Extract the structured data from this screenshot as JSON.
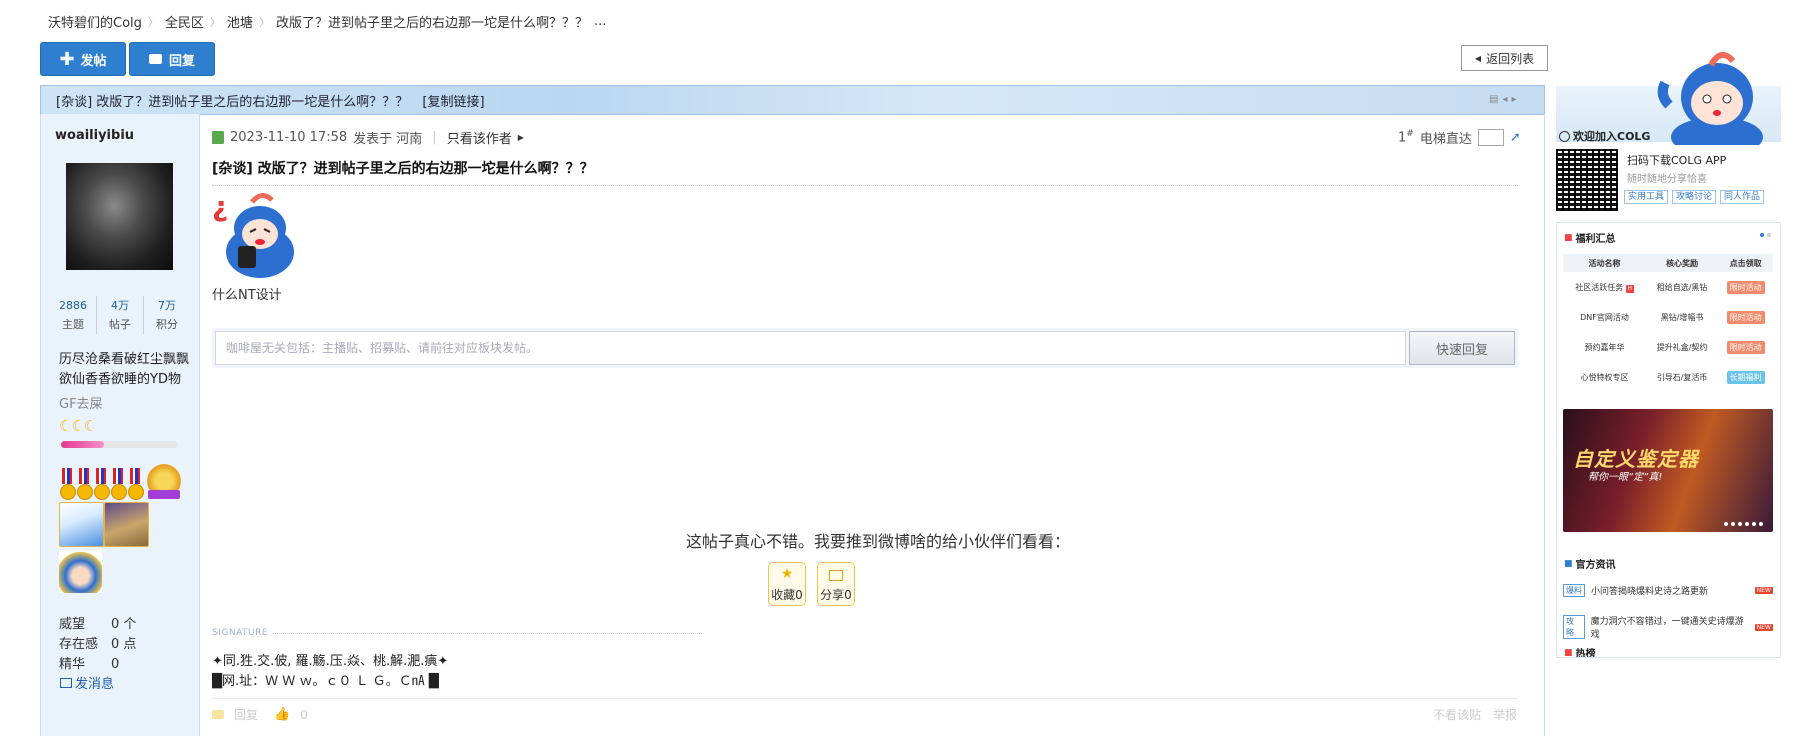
{
  "breadcrumbs": [
    "沃特碧们的Colg",
    "全民区",
    "池塘",
    "改版了？进到帖子里之后的右边那一坨是什么啊？？？",
    "..."
  ],
  "toolbar": {
    "post_label": "发帖",
    "reply_label": "回复",
    "back_label": "返回列表"
  },
  "thread": {
    "title": "[杂谈] 改版了？进到帖子里之后的右边那一坨是什么啊？？？",
    "copy_link": "[复制链接]"
  },
  "author": {
    "name": "woailiyibiu",
    "stats": [
      {
        "value": "2886",
        "label": "主题"
      },
      {
        "value": "4万",
        "label": "帖子"
      },
      {
        "value": "7万",
        "label": "积分"
      }
    ],
    "motto": "历尽沧桑看破红尘飘飘欲仙香香欲睡的YD物",
    "group": "GF去屎",
    "exp_progress": 0.37,
    "info": [
      {
        "k": "威望",
        "v": "0 个"
      },
      {
        "k": "存在感",
        "v": "0 点"
      },
      {
        "k": "精华",
        "v": "0"
      }
    ],
    "send_msg": "发消息"
  },
  "post": {
    "meta_time": "2023-11-10 17:58",
    "meta_from": "发表于 河南",
    "only_author": "只看该作者",
    "floor": "1",
    "floor_sup": "#",
    "elevator": "电梯直达",
    "title": "[杂谈] 改版了？进到帖子里之后的右边那一坨是什么啊？？？",
    "body": "什么NT设计",
    "quick_placeholder": "咖啡屋无关包括：主播贴、招募贴、请前往对应板块发帖。",
    "quick_btn": "快速回复",
    "share_text": "这帖子真心不错。我要推到微博啥的给小伙伴们看看：",
    "fav_label": "收藏0",
    "share_label": "分享0",
    "sig_label": "SIGNATURE",
    "sig_line1": "✦同.狌.交.佊, 羅.觞.压.焱、桃.解.淝.痶✦",
    "sig_line2": "█网.址：Ｗ Ｗ ｗ。ｃ０ Ｌ Ｇ。Ｃ㎁ █",
    "reply": "回复",
    "likes": "0",
    "no_see": "不看该贴",
    "report": "举报"
  },
  "right": {
    "welcome": "欢迎加入COLG",
    "app_title": "扫码下载COLG APP",
    "app_sub": "随时随地分享恰喜",
    "app_tags": [
      "实用工具",
      "攻略讨论",
      "同人作品"
    ],
    "fuli_title": "福利汇总",
    "fuli_headers": [
      "活动名称",
      "核心奖励",
      "点击领取"
    ],
    "fuli_rows": [
      {
        "name": "社区活跃任务",
        "hot": "H",
        "reward": "租给自选/黑钻",
        "tag": "限时活动",
        "color": "#f28a6b"
      },
      {
        "name": "DNF官网活动",
        "hot": "",
        "reward": "黑钻/增幅书",
        "tag": "限时活动",
        "color": "#f28a6b"
      },
      {
        "name": "预约嘉年华",
        "hot": "",
        "reward": "提升礼盒/契约",
        "tag": "限时活动",
        "color": "#f28a6b"
      },
      {
        "name": "心悦特权专区",
        "hot": "",
        "reward": "引导石/复活币",
        "tag": "长期福利",
        "color": "#6cc3e8"
      }
    ],
    "banner_title": "自定义鉴定器",
    "banner_sub": "帮你一眼“定”真!",
    "news_title": "官方资讯",
    "news": [
      {
        "type": "爆料",
        "text": "小问答揭晓爆料史诗之路更新",
        "badge": "NEW"
      },
      {
        "type": "攻略",
        "text": "魔力洞穴不容错过，一键通关史诗爆游戏",
        "badge": "NEW"
      }
    ],
    "hot_title": "热榜"
  },
  "colors": {
    "accent": "#2f7fd1",
    "sidebar_bg": "#eaf3fb",
    "exp_bar": "#e43a8f"
  }
}
